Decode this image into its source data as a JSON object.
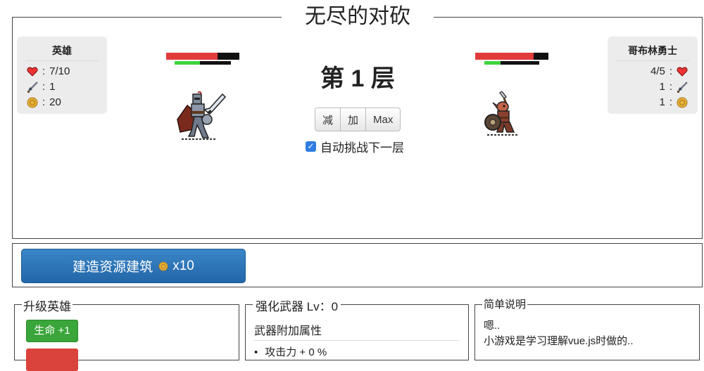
{
  "game": {
    "title": "无尽的对砍"
  },
  "hero": {
    "name": "英雄",
    "hp_text": "7/10",
    "attack": "1",
    "gold": "20",
    "hp_fraction": 0.7,
    "mana_fraction": 0.45
  },
  "enemy": {
    "name": "哥布林勇士",
    "hp_text": "4/5",
    "attack": "1",
    "gold": "1",
    "hp_fraction": 0.8,
    "mana_fraction": 0.3
  },
  "stage": {
    "floor_label": "第 1 层",
    "minus_label": "减",
    "plus_label": "加",
    "max_label": "Max",
    "auto_label": "自动挑战下一层",
    "auto_checked": true
  },
  "build": {
    "label": "建造资源建筑",
    "cost": "x10"
  },
  "upgrade_hero": {
    "title": "升级英雄",
    "hp_button": "生命 +1"
  },
  "weapon": {
    "title": "强化武器 Lv：0",
    "subtitle": "武器附加属性",
    "first_item": "攻击力 + 0 %"
  },
  "help": {
    "title": "简单说明",
    "line1": "嗯..",
    "line2": "小游戏是学习理解vue.js时做的.."
  },
  "colors": {
    "hp": "#e23b3b",
    "mana": "#3ed43e",
    "build_button": "#2a72b5",
    "green_button": "#3aa53a"
  }
}
